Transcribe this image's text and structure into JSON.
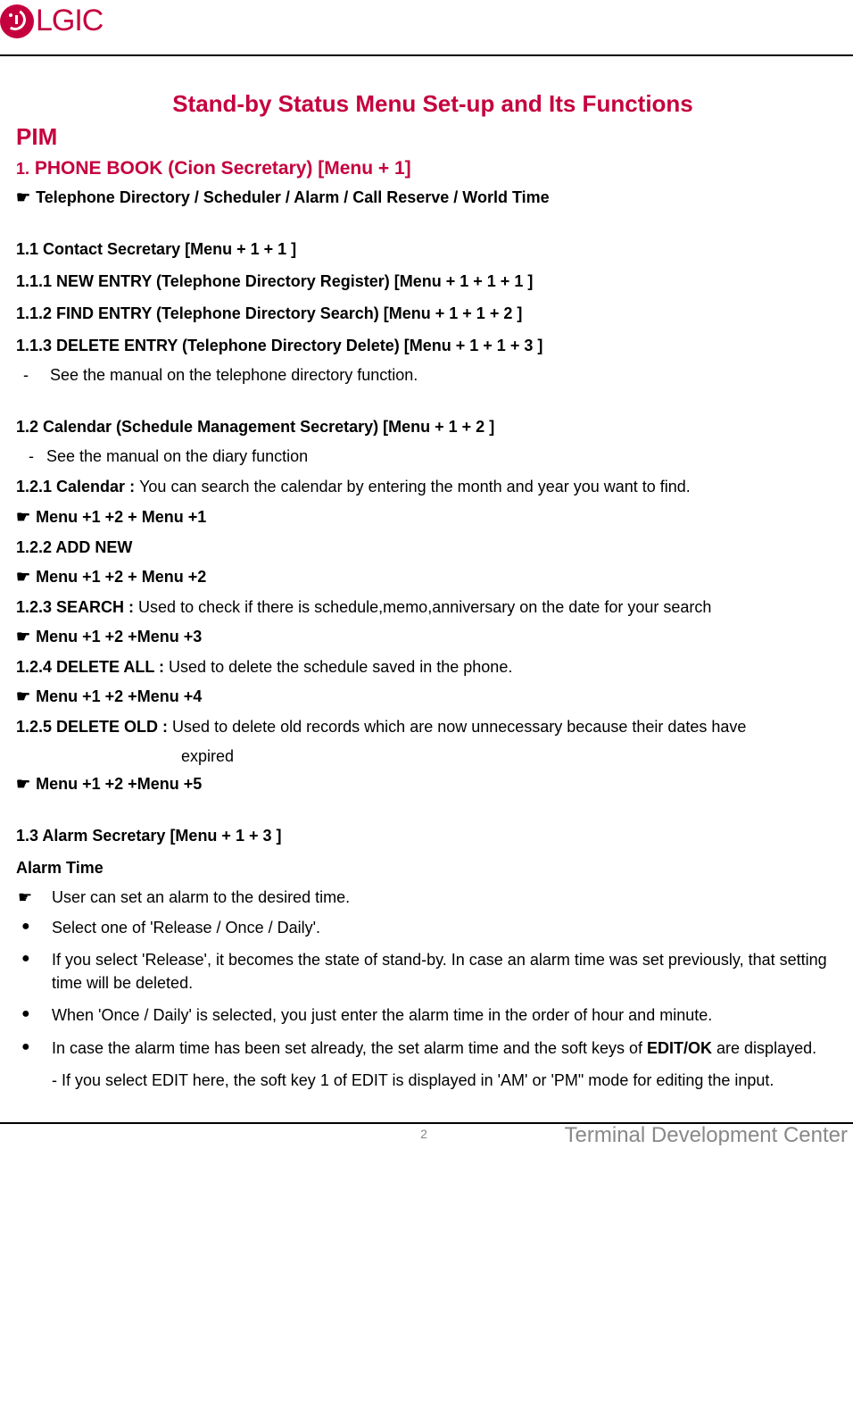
{
  "header": {
    "logo_text": "LGIC"
  },
  "title": "Stand-by Status Menu Set-up and Its Functions",
  "h2_pim": "PIM",
  "s1": {
    "heading_num": "1.",
    "heading_rest": " PHONE BOOK (Cion Secretary) [Menu + 1]",
    "subhead": "Telephone Directory / Scheduler / Alarm / Call Reserve / World Time"
  },
  "s1_1": {
    "h": "1.1    Contact Secretary [Menu + 1 + 1 ]",
    "l1": "1.1.1 NEW ENTRY (Telephone Directory Register) [Menu + 1 + 1 + 1 ]",
    "l2": "1.1.2 FIND ENTRY (Telephone Directory Search) [Menu + 1 + 1 + 2 ]",
    "l3": "1.1.3 DELETE ENTRY (Telephone Directory Delete) [Menu + 1 + 1 + 3 ]",
    "note": "See the manual on the telephone directory function."
  },
  "s1_2": {
    "h": "1.2    Calendar (Schedule Management Secretary) [Menu + 1 + 2 ]",
    "note": "See the manual on the diary function",
    "i1_b": "1.2.1 Calendar : ",
    "i1_t": "You can search the calendar by entering the month and year you want to find.",
    "i1_m": "Menu +1 +2 + Menu +1",
    "i2_b": "1.2.2 ADD NEW",
    "i2_m": "Menu +1 +2 + Menu +2",
    "i3_b": "1.2.3 SEARCH : ",
    "i3_t": "Used to check if there is schedule,memo,anniversary on the date for your search",
    "i3_m": "Menu +1 +2 +Menu +3",
    "i4_b": "1.2.4 DELETE ALL : ",
    "i4_t": "Used to delete the schedule saved in the phone.",
    "i4_m": "Menu +1 +2 +Menu +4",
    "i5_b": "1.2.5 DELETE OLD : ",
    "i5_t": "Used to delete old records which are now unnecessary because their dates have",
    "i5_cont": "expired",
    "i5_m": "Menu +1 +2 +Menu +5"
  },
  "s1_3": {
    "h": "1.3    Alarm Secretary [Menu + 1 + 3 ]",
    "sub": "Alarm Time",
    "user": "User can set an alarm to the desired time.",
    "b1": "Select one of 'Release / Once / Daily'.",
    "b2": "If you select 'Release', it becomes the state of stand-by. In case an alarm time was set previously, that setting time will be deleted.",
    "b3": "When 'Once / Daily' is selected, you just enter the alarm time in the order of hour and minute.",
    "b4_pre": "In case the alarm time has been set already, the set alarm time and the soft keys of ",
    "b4_bold": "EDIT/OK",
    "b4_post": " are displayed.",
    "b4_sub_pre": "- If you select ",
    "b4_sub_b1": "EDIT",
    "b4_sub_mid": " here, the soft key 1 of ",
    "b4_sub_b2": "EDIT",
    "b4_sub_post": " is displayed in 'AM' or 'PM\" mode for editing the input."
  },
  "footer": {
    "center": "2",
    "right": "Terminal Development Center"
  },
  "glyphs": {
    "pointer": "☛",
    "bullet": "●",
    "dash": "-"
  }
}
